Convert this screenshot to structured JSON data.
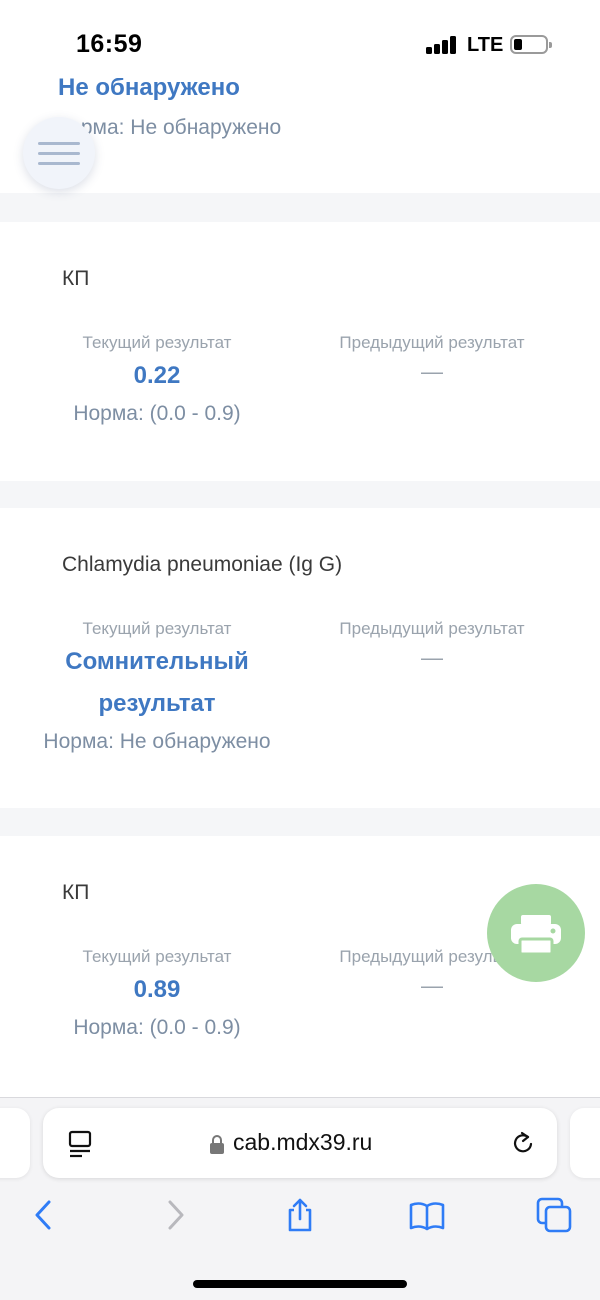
{
  "status_bar": {
    "time": "16:59",
    "network": "LTE",
    "icons": [
      "signal-bars-icon",
      "battery-icon"
    ]
  },
  "top_card": {
    "value": "Не обнаружено",
    "norm": "Норма: Не обнаружено"
  },
  "cards": [
    {
      "title": "КП",
      "current_label": "Текущий результат",
      "current_value": "0.22",
      "previous_label": "Предыдущий результат",
      "previous_value": "—",
      "norm": "Норма: (0.0 - 0.9)"
    },
    {
      "title": "Chlamydia pneumoniae (Ig G)",
      "current_label": "Текущий результат",
      "current_value": "Сомнительный результат",
      "previous_label": "Предыдущий результат",
      "previous_value": "—",
      "norm": "Норма: Не обнаружено"
    },
    {
      "title": "КП",
      "current_label": "Текущий результат",
      "current_value": "0.89",
      "previous_label": "Предыдущий результат",
      "previous_value": "—",
      "norm": "Норма: (0.0 - 0.9)"
    }
  ],
  "floating": {
    "menu_icon": "hamburger-menu-icon",
    "print_icon": "printer-icon"
  },
  "browser": {
    "url": "cab.mdx39.ru",
    "icons": [
      "reader-icon",
      "lock-icon",
      "reload-icon",
      "back-icon",
      "forward-icon",
      "share-icon",
      "bookmarks-icon",
      "tabs-icon"
    ]
  },
  "colors": {
    "accent_blue": "#3f78c2",
    "muted_text": "#7d8ea3",
    "label_gray": "#9aa3ad",
    "print_green": "#a7d8a2",
    "ios_blue": "#2f7cf6"
  }
}
